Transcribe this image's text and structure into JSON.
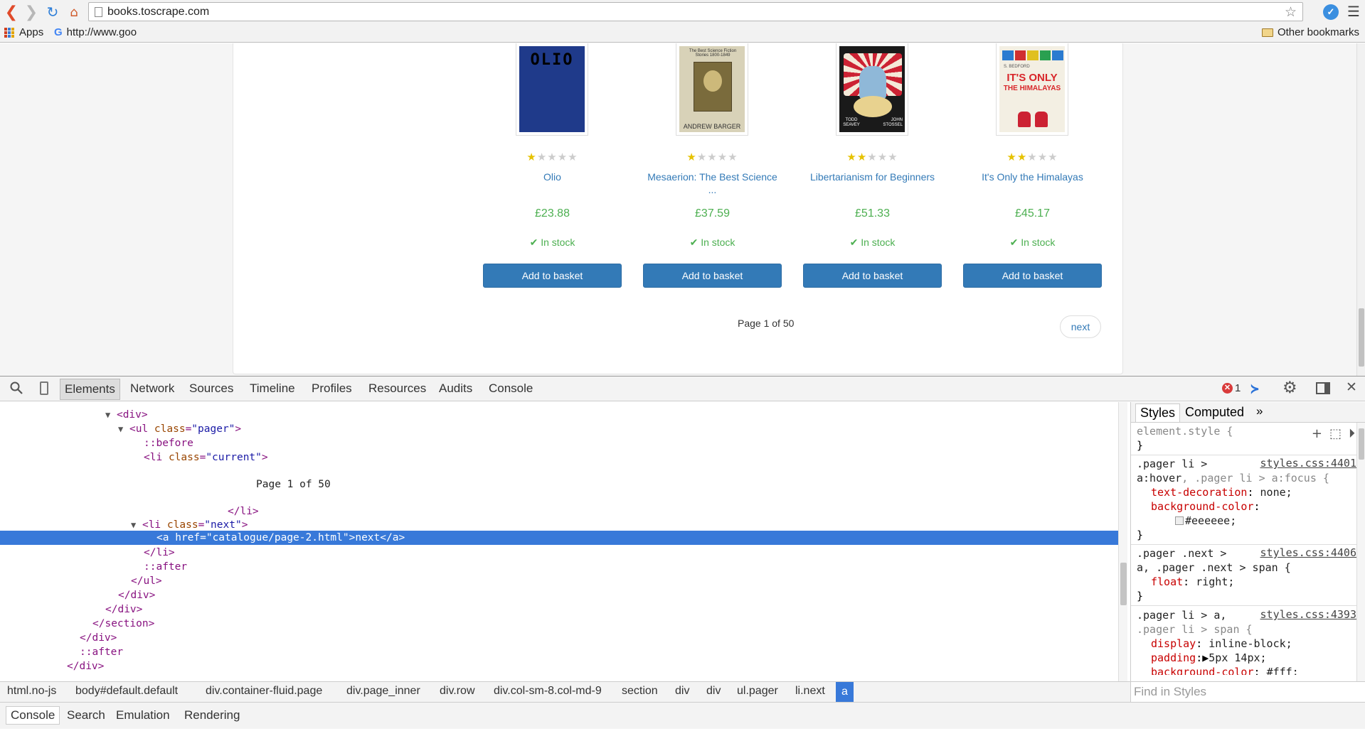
{
  "browser": {
    "url": "books.toscrape.com",
    "bookmarks": {
      "apps": "Apps",
      "google": "http://www.goo",
      "other": "Other bookmarks"
    },
    "extension_letter": "✓"
  },
  "products": [
    {
      "title": "Olio",
      "title_line2": "",
      "price": "£23.88",
      "stock": "In stock",
      "rating": 1,
      "button": "Add to basket",
      "cover_color": "#1f3a8a"
    },
    {
      "title": "Mesaerion: The Best Science",
      "title_line2": "...",
      "price": "£37.59",
      "stock": "In stock",
      "rating": 1,
      "button": "Add to basket",
      "cover_color": "#c9c2a4"
    },
    {
      "title": "Libertarianism for Beginners",
      "title_line2": "",
      "price": "£51.33",
      "stock": "In stock",
      "rating": 2,
      "button": "Add to basket",
      "cover_color": "#222222"
    },
    {
      "title": "It's Only the Himalayas",
      "title_line2": "",
      "price": "£45.17",
      "stock": "In stock",
      "rating": 2,
      "button": "Add to basket",
      "cover_color": "#f3efe3"
    }
  ],
  "covers": {
    "olio": "OLIO",
    "mesaerion_top": "The Best Science Fiction Stories 1800-1849",
    "mesaerion_author": "ANDREW BARGER",
    "libertarian_left": "TODD SEAVEY",
    "libertarian_right": "JOHN STOSSEL",
    "himalayas_author": "S. BEDFORD",
    "himalayas_title_1": "IT'S ONLY",
    "himalayas_title_2": "THE HIMALAYAS"
  },
  "pager": {
    "current": "Page 1 of 50",
    "next": "next"
  },
  "devtools": {
    "tabs": [
      "Elements",
      "Network",
      "Sources",
      "Timeline",
      "Profiles",
      "Resources",
      "Audits",
      "Console"
    ],
    "error_count": "1",
    "dom": {
      "div_open": "<div>",
      "ul_open_tag": "ul",
      "ul_class_attr": "class",
      "ul_class_val": "\"pager\"",
      "before": "::before",
      "li_current_tag": "li",
      "li_current_val": "\"current\"",
      "page_text": "Page 1 of 50",
      "li_close": "</li>",
      "li_next_val": "\"next\"",
      "selected_line": "<a href=\"catalogue/page-2.html\">next</a>",
      "li_close2": "</li>",
      "after": "::after",
      "ul_close": "</ul>",
      "div_close1": "</div>",
      "div_close2": "</div>",
      "section_close": "</section>",
      "div_close3": "</div>",
      "after2": "::after",
      "div_close4": "</div>"
    },
    "breadcrumbs": [
      "html.no-js",
      "body#default.default",
      "div.container-fluid.page",
      "div.page_inner",
      "div.row",
      "div.col-sm-8.col-md-9",
      "section",
      "div",
      "div",
      "ul.pager",
      "li.next",
      "a"
    ],
    "styles": {
      "tab_styles": "Styles",
      "tab_computed": "Computed",
      "element_style": "element.style {",
      "rule1_sel_a": ".pager li >",
      "rule1_link": "styles.css:4401",
      "rule1_sel_b": "a:hover",
      "rule1_sel_c": ", .pager li > a:focus {",
      "rule1_p1": "text-decoration",
      "rule1_v1": "none;",
      "rule1_p2": "background-color",
      "rule1_v2": "#eeeeee;",
      "rule2_sel_a": ".pager .next >",
      "rule2_link": "styles.css:4406",
      "rule2_sel_b": "a, .pager .next > span {",
      "rule2_p1": "float",
      "rule2_v1": "right;",
      "rule3_sel_a": ".pager li > a,",
      "rule3_link": "styles.css:4393",
      "rule3_sel_b": ".pager li > span {",
      "rule3_p1": "display",
      "rule3_v1": "inline-block;",
      "rule3_p2": "padding",
      "rule3_v2": "5px 14px;",
      "rule3_p3": "background-color",
      "rule3_v3": "#fff;",
      "close_brace": "}",
      "find_placeholder": "Find in Styles"
    },
    "drawer_tabs": [
      "Console",
      "Search",
      "Emulation",
      "Rendering"
    ]
  }
}
